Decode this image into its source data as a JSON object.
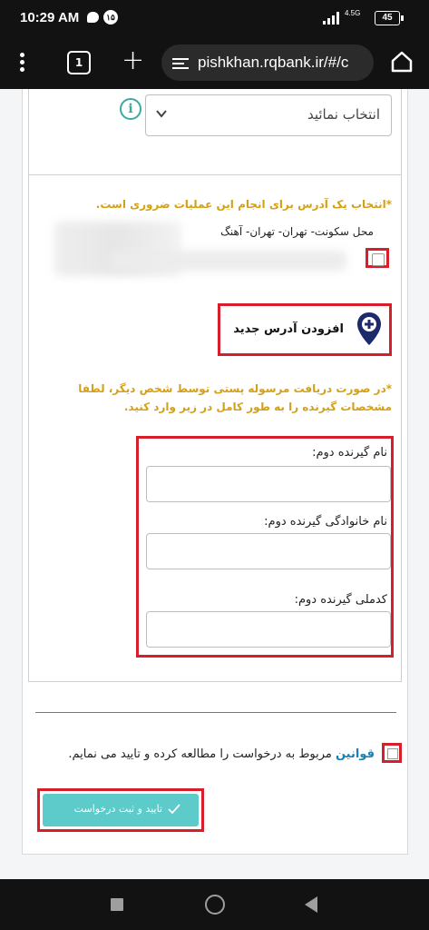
{
  "status_bar": {
    "time": "10:29 AM",
    "notification_count": "۱۵",
    "network": "4.5G",
    "battery": "45"
  },
  "browser": {
    "tab_count": "1",
    "url": "pishkhan.rqbank.ir/#/c"
  },
  "form": {
    "select_value": "انتخاب نمائید",
    "required_note": "*انتخاب یک آدرس برای انجام این عملیات ضروری است.",
    "address_text": "محل سکونت- تهران- تهران- آهنگ",
    "add_address_label": "افزودن آدرس جدید",
    "second_recipient_note": "*در صورت دریافت مرسوله پستی توسط شخص دیگر، لطفا مشخصات گیرنده را به طور کامل در زیر وارد کنید.",
    "fields": [
      {
        "label": "نام گیرنده دوم:",
        "value": ""
      },
      {
        "label": "نام خانوادگی گیرنده دوم:",
        "value": ""
      },
      {
        "label": "کدملی گیرنده دوم:",
        "value": ""
      }
    ],
    "terms_link": "قوانین",
    "terms_text": " مربوط به درخواست را مطالعه کرده و تایید می نمایم.",
    "submit_label": "تایید و ثبت درخواست"
  },
  "colors": {
    "warning": "#d4a017",
    "highlight": "#d71f2b",
    "primary_button": "#5ccbc9",
    "link": "#1a7fb5",
    "pin": "#1d2a6b"
  }
}
